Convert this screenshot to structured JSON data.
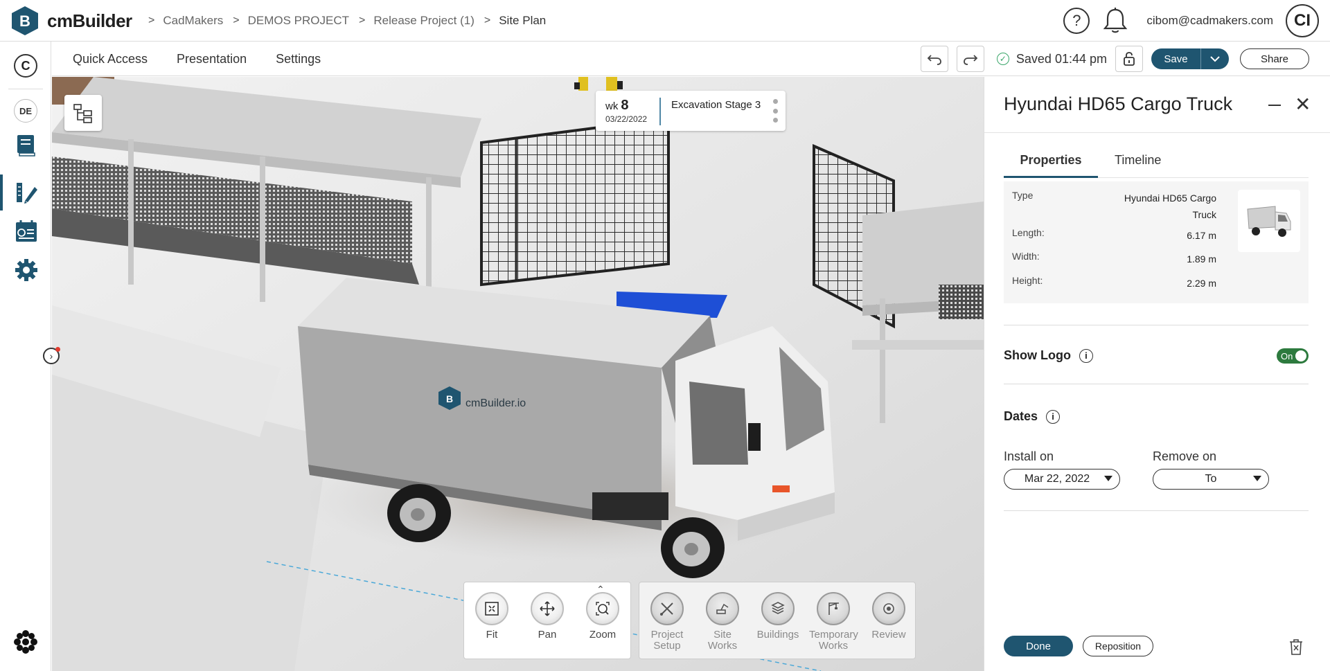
{
  "brand": {
    "name": "cmBuilder",
    "logo_letter": "B",
    "accent": "#1f5570"
  },
  "breadcrumbs": [
    "CadMakers",
    "DEMOS PROJECT",
    "Release Project (1)",
    "Site Plan"
  ],
  "user": {
    "email": "cibom@cadmakers.com",
    "initials": "CI"
  },
  "header": {
    "help_icon": "help-icon",
    "notifications_icon": "bell-icon"
  },
  "sidebar": {
    "org_initial": "C",
    "project_initials": "DE",
    "items": [
      "book-icon",
      "design-icon",
      "schedule-icon",
      "settings-icon"
    ],
    "bottom_icon": "apps-icon"
  },
  "subbar": {
    "menu": [
      "Quick Access",
      "Presentation",
      "Settings"
    ],
    "saved_text": "Saved 01:44 pm",
    "save_label": "Save",
    "share_label": "Share"
  },
  "viewport": {
    "week_label": "wk",
    "week_number": "8",
    "week_date": "03/22/2022",
    "stage": "Excavation Stage 3",
    "truck_logo_text": "cmBuilder.io",
    "nav_tools": [
      "Fit",
      "Pan",
      "Zoom"
    ],
    "category_tools": [
      "Project Setup",
      "Site Works",
      "Buildings",
      "Temporary Works",
      "Review"
    ]
  },
  "panel": {
    "title": "Hyundai HD65 Cargo Truck",
    "tabs": [
      "Properties",
      "Timeline"
    ],
    "properties": [
      {
        "label": "Type",
        "value": "Hyundai HD65 Cargo Truck"
      },
      {
        "label": "Length:",
        "value": "6.17 m"
      },
      {
        "label": "Width:",
        "value": "1.89 m"
      },
      {
        "label": "Height:",
        "value": "2.29 m"
      }
    ],
    "show_logo_label": "Show Logo",
    "show_logo_toggle": "On",
    "dates_label": "Dates",
    "install_label": "Install on",
    "install_value": "Mar 22, 2022",
    "remove_label": "Remove on",
    "remove_value": "To",
    "done_label": "Done",
    "reposition_label": "Reposition"
  }
}
